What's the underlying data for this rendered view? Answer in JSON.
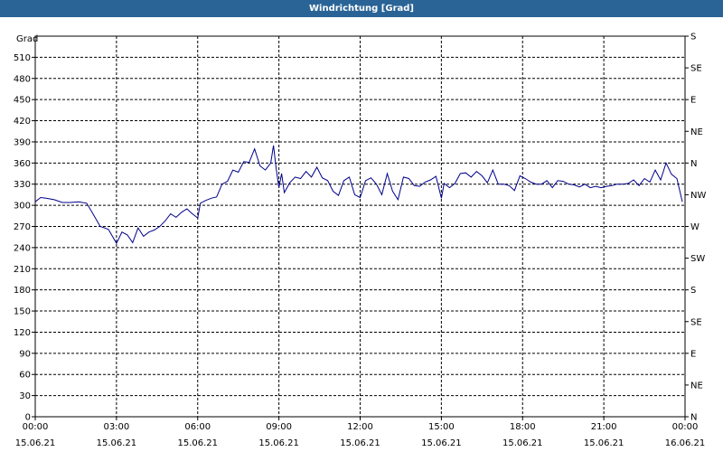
{
  "window": {
    "title": "Windrichtung [Grad]"
  },
  "colors": {
    "titlebar": "#2a6496",
    "series": "#00008b",
    "grid": "#000000"
  },
  "chart_data": {
    "type": "line",
    "title": "Windrichtung [Grad]",
    "ylabel": "Grad",
    "ylim": [
      0,
      540
    ],
    "yticks": [
      0,
      30,
      60,
      90,
      120,
      150,
      180,
      210,
      240,
      270,
      300,
      330,
      360,
      390,
      420,
      450,
      480,
      510
    ],
    "right_axis": {
      "labels": [
        "N",
        "NE",
        "E",
        "SE",
        "S",
        "SW",
        "W",
        "NW",
        "N",
        "NE",
        "E",
        "SE",
        "S"
      ],
      "values": [
        0,
        45,
        90,
        135,
        180,
        225,
        270,
        315,
        360,
        405,
        450,
        495,
        540
      ]
    },
    "xlim": [
      0,
      24
    ],
    "xticks": [
      {
        "time": "00:00",
        "date": "15.06.21"
      },
      {
        "time": "03:00",
        "date": "15.06.21"
      },
      {
        "time": "06:00",
        "date": "15.06.21"
      },
      {
        "time": "09:00",
        "date": "15.06.21"
      },
      {
        "time": "12:00",
        "date": "15.06.21"
      },
      {
        "time": "15:00",
        "date": "15.06.21"
      },
      {
        "time": "18:00",
        "date": "15.06.21"
      },
      {
        "time": "21:00",
        "date": "15.06.21"
      },
      {
        "time": "00:00",
        "date": "16.06.21"
      }
    ],
    "grid": true,
    "series": [
      {
        "x": [
          0,
          0.2,
          0.4,
          0.7,
          1.0,
          1.3,
          1.6,
          1.9,
          2.1,
          2.4,
          2.7,
          3.0,
          3.2,
          3.4,
          3.6,
          3.8,
          4.0,
          4.2,
          4.4,
          4.6,
          4.8,
          5.0,
          5.2,
          5.4,
          5.6,
          5.8,
          6.0,
          6.1,
          6.3,
          6.5,
          6.7,
          6.9,
          7.1,
          7.3,
          7.5,
          7.7,
          7.9,
          8.1,
          8.3,
          8.5,
          8.7,
          8.8,
          8.9,
          9.0,
          9.1,
          9.2,
          9.4,
          9.6,
          9.8,
          10.0,
          10.2,
          10.4,
          10.6,
          10.8,
          11.0,
          11.2,
          11.4,
          11.6,
          11.8,
          12.0,
          12.2,
          12.4,
          12.6,
          12.8,
          13.0,
          13.2,
          13.4,
          13.6,
          13.8,
          14.0,
          14.2,
          14.4,
          14.6,
          14.8,
          15.0,
          15.1,
          15.3,
          15.5,
          15.7,
          15.9,
          16.1,
          16.3,
          16.5,
          16.7,
          16.9,
          17.1,
          17.3,
          17.5,
          17.7,
          17.9,
          18.1,
          18.3,
          18.5,
          18.7,
          18.9,
          19.1,
          19.3,
          19.5,
          19.7,
          19.9,
          20.1,
          20.3,
          20.5,
          20.7,
          20.9,
          21.1,
          21.3,
          21.5,
          21.7,
          21.9,
          22.1,
          22.3,
          22.5,
          22.7,
          22.9,
          23.1,
          23.3,
          23.5,
          23.7,
          23.9
        ],
        "y": [
          305,
          311,
          310,
          308,
          304,
          304,
          305,
          303,
          290,
          270,
          266,
          246,
          262,
          258,
          247,
          268,
          256,
          262,
          265,
          270,
          278,
          288,
          283,
          290,
          295,
          288,
          282,
          303,
          307,
          310,
          312,
          330,
          334,
          350,
          347,
          362,
          361,
          380,
          356,
          350,
          360,
          385,
          352,
          325,
          345,
          318,
          332,
          340,
          338,
          348,
          340,
          354,
          339,
          335,
          320,
          314,
          335,
          340,
          315,
          311,
          335,
          339,
          330,
          315,
          345,
          320,
          308,
          340,
          338,
          328,
          327,
          333,
          336,
          341,
          310,
          331,
          325,
          331,
          345,
          346,
          340,
          348,
          342,
          332,
          350,
          330,
          330,
          328,
          321,
          342,
          338,
          333,
          330,
          330,
          335,
          325,
          335,
          334,
          330,
          329,
          326,
          330,
          325,
          327,
          325,
          327,
          328,
          330,
          330,
          331,
          336,
          328,
          338,
          333,
          350,
          336,
          360,
          344,
          338,
          305
        ]
      }
    ]
  }
}
